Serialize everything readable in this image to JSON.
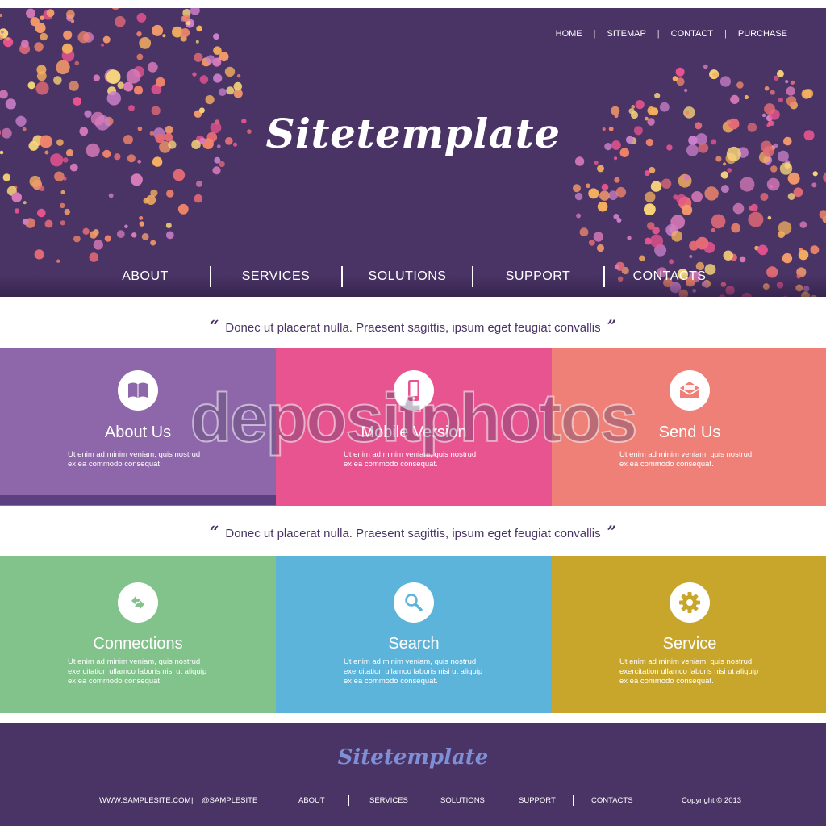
{
  "colors": {
    "header_bg": "#4a3466",
    "about": "#8e67aa",
    "mobile": "#e8548f",
    "send": "#ef8078",
    "connections": "#82c28b",
    "search": "#5cb4da",
    "service": "#c8a62c",
    "footer_logo": "#7f8fd6"
  },
  "top_nav": [
    "HOME",
    "SITEMAP",
    "CONTACT",
    "PURCHASE"
  ],
  "top_nav_separator": "|",
  "logo": "Sitetemplate",
  "main_nav": [
    "ABOUT",
    "SERVICES",
    "SOLUTIONS",
    "SUPPORT",
    "CONTACTS"
  ],
  "quote_open": "“",
  "quote_close": "”",
  "quote_1": "Donec ut placerat nulla. Praesent sagittis, ipsum eget feugiat convallis",
  "quote_2": "Donec ut placerat nulla. Praesent sagittis, ipsum eget feugiat convallis",
  "features_row1": [
    {
      "title": "About Us",
      "icon": "book-icon",
      "text_1": "Ut enim ad minim veniam, quis nostrud",
      "text_2": "ex ea commodo consequat."
    },
    {
      "title": "Mobile Version",
      "icon": "mobile-phone-icon",
      "text_1": "Ut enim ad minim veniam, quis nostrud",
      "text_2": "ex ea commodo consequat."
    },
    {
      "title": "Send Us",
      "icon": "envelope-icon",
      "text_1": "Ut enim ad minim veniam, quis nostrud",
      "text_2": "ex ea commodo consequat."
    }
  ],
  "features_row2": [
    {
      "title": "Connections",
      "icon": "sync-arrows-icon",
      "text_1": "Ut enim ad minim veniam, quis nostrud",
      "text_2": "exercitation ullamco laboris nisi ut aliquip",
      "text_3": "ex ea commodo consequat."
    },
    {
      "title": "Search",
      "icon": "magnifier-icon",
      "text_1": "Ut enim ad minim veniam, quis nostrud",
      "text_2": "exercitation ullamco laboris nisi ut aliquip",
      "text_3": "ex ea commodo consequat."
    },
    {
      "title": "Service",
      "icon": "gear-icon",
      "text_1": "Ut enim ad minim veniam, quis nostrud",
      "text_2": "exercitation ullamco laboris nisi ut aliquip",
      "text_3": "ex ea commodo consequat."
    }
  ],
  "watermark": "depositphotos",
  "footer": {
    "logo": "Sitetemplate",
    "website": "WWW.SAMPLESITE.COM",
    "separator": "|",
    "social": "@SAMPLESITE",
    "nav": [
      "ABOUT",
      "SERVICES",
      "SOLUTIONS",
      "SUPPORT",
      "CONTACTS"
    ],
    "copyright": "Copyright © 2013"
  }
}
